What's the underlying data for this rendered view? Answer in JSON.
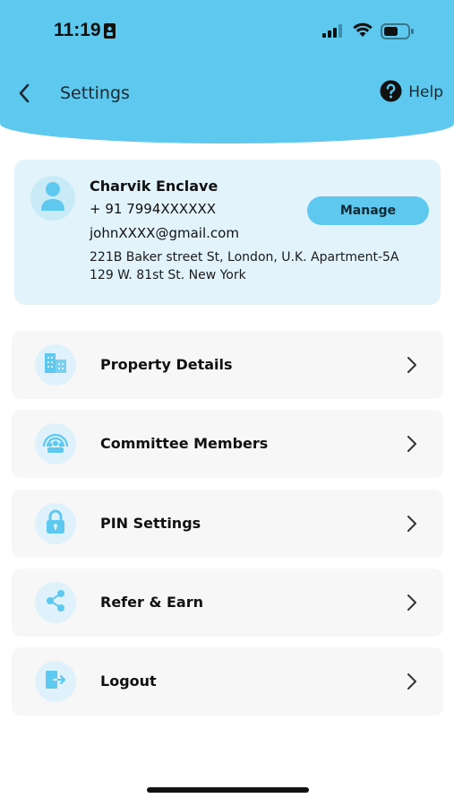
{
  "status": {
    "time": "11:19"
  },
  "header": {
    "title": "Settings",
    "help_label": "Help"
  },
  "profile": {
    "name": "Charvik Enclave",
    "phone": "+ 91 7994XXXXXX",
    "email": "johnXXXX@gmail.com",
    "address": "221B Baker street St, London, U.K. Apartment-5A 129 W. 81st St. New York",
    "manage_label": "Manage"
  },
  "menu": {
    "items": [
      {
        "label": "Property Details",
        "icon": "building-icon"
      },
      {
        "label": "Committee Members",
        "icon": "group-icon"
      },
      {
        "label": "PIN Settings",
        "icon": "lock-icon"
      },
      {
        "label": "Refer & Earn",
        "icon": "share-icon"
      },
      {
        "label": "Logout",
        "icon": "logout-icon"
      }
    ]
  },
  "colors": {
    "accent": "#5ec8ef",
    "card_bg": "#e2f3fb",
    "menu_bg": "#f7f7f7",
    "icon_bg": "#dff2fb"
  }
}
